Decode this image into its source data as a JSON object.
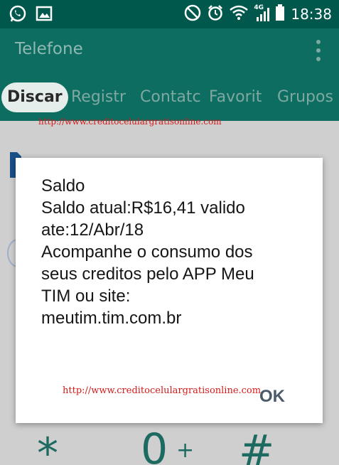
{
  "status_bar": {
    "time": "18:38",
    "network": "4G",
    "icons": [
      "whatsapp-icon",
      "gallery-icon",
      "do-not-disturb-icon",
      "alarm-icon",
      "wifi-icon",
      "signal-icon",
      "battery-icon"
    ]
  },
  "toolbar": {
    "title": "Telefone",
    "menu_icon": "overflow-menu-icon"
  },
  "tabs": [
    {
      "label": "Discar",
      "active": true
    },
    {
      "label": "Registr",
      "active": false
    },
    {
      "label": "Contatc",
      "active": false
    },
    {
      "label": "Favorit",
      "active": false
    },
    {
      "label": "Grupos",
      "active": false
    }
  ],
  "background": {
    "watermark": "http://www.creditocelulargratisonline.com",
    "keys": [
      "*",
      "0",
      "+",
      "#"
    ]
  },
  "dialog": {
    "lines": [
      "Saldo",
      "Saldo atual:R$16,41 valido",
      "ate:12/Abr/18",
      "Acompanhe o consumo dos",
      "seus creditos pelo APP Meu",
      "TIM ou site:",
      "meutim.tim.com.br"
    ],
    "watermark": "http://www.creditocelulargratisonline.com",
    "ok_label": "OK"
  },
  "colors": {
    "status_bar": "#00584c",
    "toolbar": "#0d6d61",
    "watermark": "#d41a1a"
  }
}
